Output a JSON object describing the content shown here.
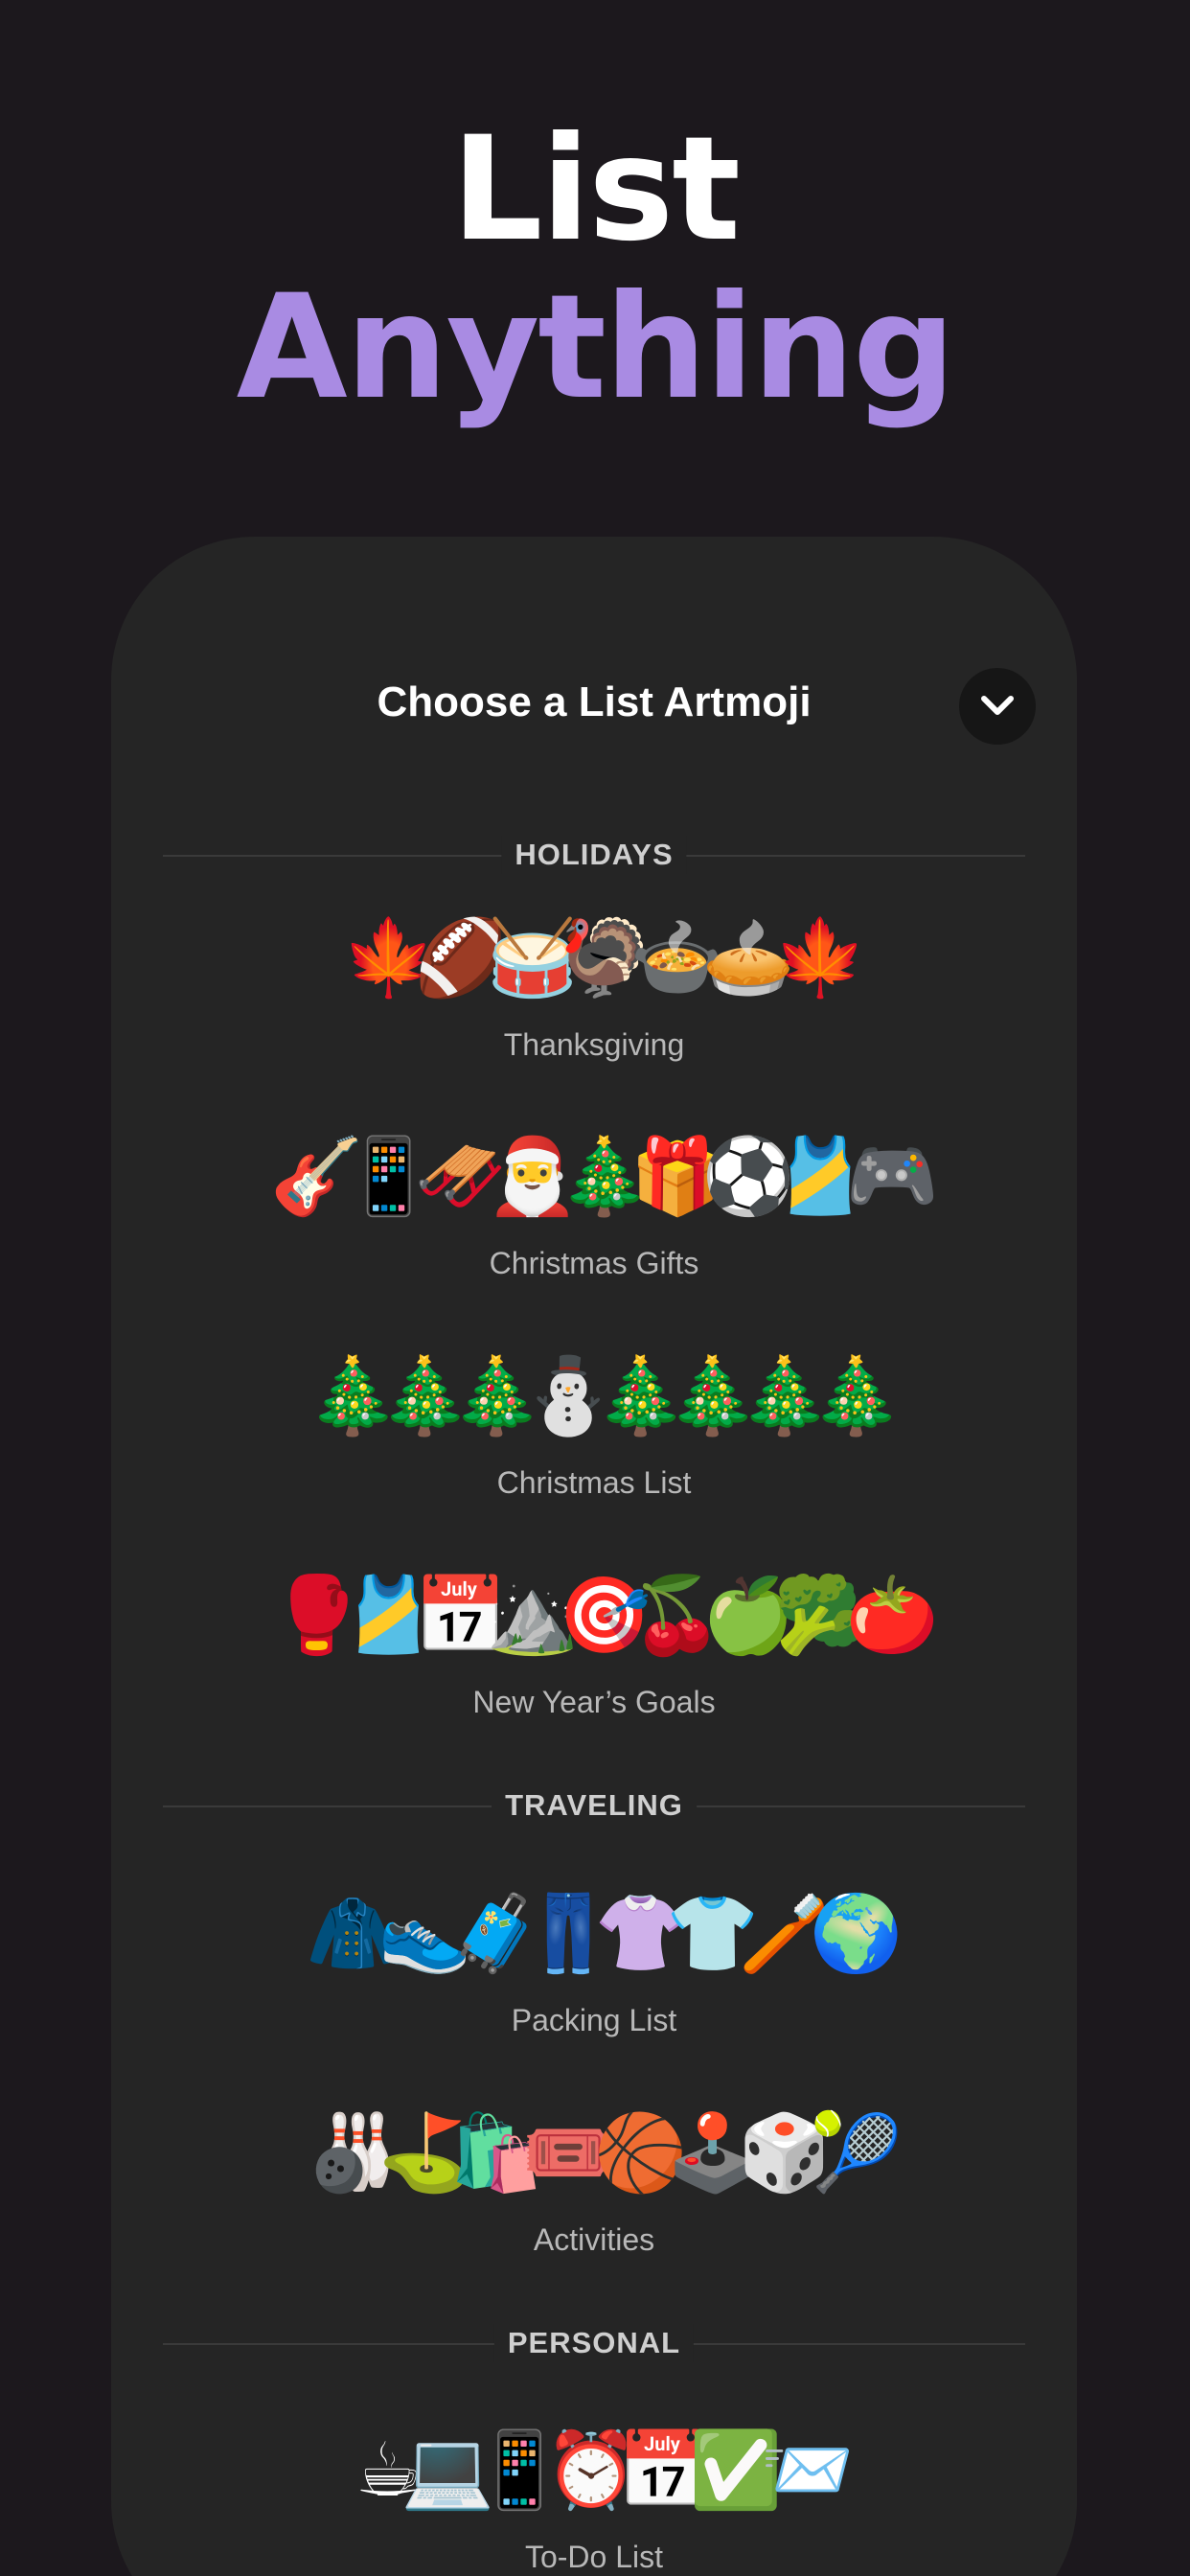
{
  "headline": {
    "line1": "List",
    "line2": "Anything"
  },
  "colors": {
    "background": "#1c181d",
    "accent": "#a98be3",
    "sheet": "#252525"
  },
  "sheet": {
    "title": "Choose a List Artmoji",
    "close_icon": "chevron-down-icon",
    "sections": [
      {
        "title": "HOLIDAYS",
        "items": [
          {
            "label": "Thanksgiving",
            "artmoji": "🍁🏈🥁🦃🍲🥧🍁"
          },
          {
            "label": "Christmas Gifts",
            "artmoji": "🎸📱🛷🎅🎄🎁⚽🎽🎮"
          },
          {
            "label": "Christmas List",
            "artmoji": "🎄🎄🎄⛄🎄🎄🎄🎄"
          },
          {
            "label": "New Year’s Goals",
            "artmoji": "🥊🎽📅⛰️🎯🍒🍏🥦🍅"
          }
        ]
      },
      {
        "title": "TRAVELING",
        "items": [
          {
            "label": "Packing List",
            "artmoji": "🧥👟🧳👖👚👕🪥🌍"
          },
          {
            "label": "Activities",
            "artmoji": "🎳⛳🛍️🎟️🏀🕹️🎲🎾"
          }
        ]
      },
      {
        "title": "PERSONAL",
        "items": [
          {
            "label": "To-Do List",
            "artmoji": "☕💻📱⏰📅✅📨"
          }
        ]
      }
    ]
  }
}
